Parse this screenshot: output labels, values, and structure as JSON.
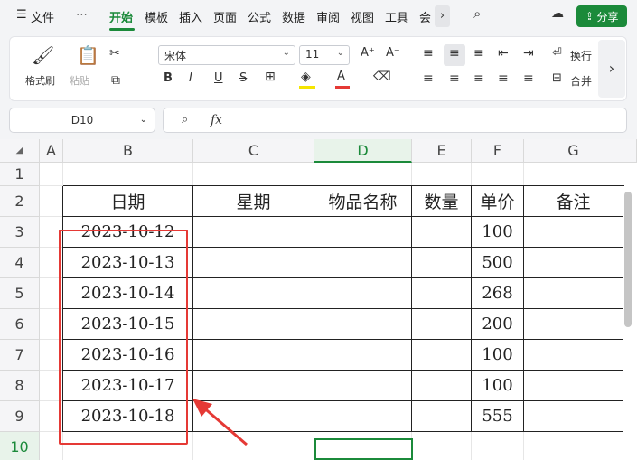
{
  "menubar": {
    "file": "文件",
    "more": "⋯",
    "tabs": [
      "开始",
      "模板",
      "插入",
      "页面",
      "公式",
      "数据",
      "审阅",
      "视图",
      "工具",
      "会"
    ],
    "share": "分享"
  },
  "ribbon": {
    "format_painter": "格式刷",
    "paste": "粘贴",
    "font_name": "宋体",
    "font_size": "11",
    "wrap": "换行",
    "merge": "合并"
  },
  "formula_bar": {
    "cell_ref": "D10",
    "fx": "fx",
    "content": ""
  },
  "sheet": {
    "columns": [
      "A",
      "B",
      "C",
      "D",
      "E",
      "F",
      "G"
    ],
    "rows": [
      "1",
      "2",
      "3",
      "4",
      "5",
      "6",
      "7",
      "8",
      "9",
      "10"
    ],
    "header": [
      "日期",
      "星期",
      "物品名称",
      "数量",
      "单价",
      "备注"
    ],
    "data": [
      [
        "2023-10-12",
        "",
        "",
        "",
        "100",
        ""
      ],
      [
        "2023-10-13",
        "",
        "",
        "",
        "500",
        ""
      ],
      [
        "2023-10-14",
        "",
        "",
        "",
        "268",
        ""
      ],
      [
        "2023-10-15",
        "",
        "",
        "",
        "200",
        ""
      ],
      [
        "2023-10-16",
        "",
        "",
        "",
        "100",
        ""
      ],
      [
        "2023-10-17",
        "",
        "",
        "",
        "100",
        ""
      ],
      [
        "2023-10-18",
        "",
        "",
        "",
        "555",
        ""
      ]
    ],
    "selected_column": "D",
    "selected_row": "10"
  }
}
